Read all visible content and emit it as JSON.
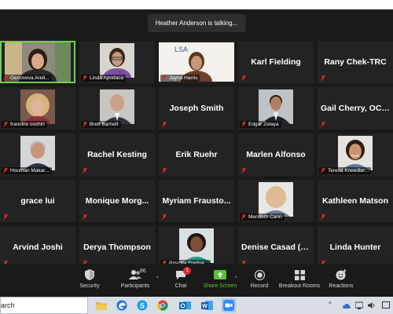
{
  "notification": {
    "text": "Heather Anderson is talking..."
  },
  "tiles": [
    {
      "name": "Genoveva Arell...",
      "display": "photo",
      "photo": "woman-dark-hair",
      "speaking": true
    },
    {
      "name": "Linda Apodaca",
      "display": "photo",
      "photo": "woman-glasses"
    },
    {
      "name": "Jayna Harris",
      "display": "photo",
      "photo": "woman-lsa-backdrop",
      "backdrop_text": "LSA"
    },
    {
      "name": "Karl Fielding",
      "display": "text"
    },
    {
      "name": "Rany Chek-TRC",
      "display": "text"
    },
    {
      "name": "francine oschin",
      "display": "photo",
      "photo": "woman-blonde"
    },
    {
      "name": "Brett Barnett",
      "display": "photo",
      "photo": "man-suit"
    },
    {
      "name": "Joseph Smith",
      "display": "text"
    },
    {
      "name": "Edgar Zelaya",
      "display": "photo",
      "photo": "man-suit-dark"
    },
    {
      "name": "Gail Cherry, OCTA",
      "display": "text"
    },
    {
      "name": "Houman Makar...",
      "display": "photo",
      "photo": "man-gray-hair"
    },
    {
      "name": "Rachel Kesting",
      "display": "text"
    },
    {
      "name": "Erik Ruehr",
      "display": "text"
    },
    {
      "name": "Marlen Alfonso",
      "display": "text"
    },
    {
      "name": "Teresa Kneedler...",
      "display": "photo",
      "photo": "woman-smiling"
    },
    {
      "name": "grace lui",
      "display": "text"
    },
    {
      "name": "Monique Morg...",
      "display": "text"
    },
    {
      "name": "Myriam Frausto...",
      "display": "text"
    },
    {
      "name": "Merideth Cann",
      "display": "photo",
      "photo": "woman-blonde-short"
    },
    {
      "name": "Kathleen Matson",
      "display": "text"
    },
    {
      "name": "Arvind Joshi",
      "display": "text"
    },
    {
      "name": "Derya Thompson",
      "display": "text"
    },
    {
      "name": "Priscilla Fredua...",
      "display": "photo",
      "photo": "woman-dark-skin"
    },
    {
      "name": "Denise Casad (E...",
      "display": "text"
    },
    {
      "name": "Linda Hunter",
      "display": "text"
    }
  ],
  "toolbar": {
    "security": {
      "label": "Security",
      "icon": "shield-icon"
    },
    "participants": {
      "label": "Participants",
      "count": "86",
      "icon": "participants-icon"
    },
    "chat": {
      "label": "Chat",
      "badge": "1",
      "icon": "chat-icon"
    },
    "share": {
      "label": "Share Screen",
      "icon": "share-screen-icon",
      "color": "#58c236"
    },
    "record": {
      "label": "Record",
      "icon": "record-icon"
    },
    "breakout": {
      "label": "Breakout Rooms",
      "icon": "breakout-rooms-icon"
    },
    "reactions": {
      "label": "Reactions",
      "icon": "reactions-icon"
    }
  },
  "taskbar": {
    "search_text": "arch",
    "apps": [
      "file-explorer-icon",
      "edge-icon",
      "skype-icon",
      "chrome-icon",
      "outlook-icon",
      "word-icon",
      "zoom-icon"
    ]
  },
  "colors": {
    "muted_mic": "#e02828",
    "speaking_border": "#6ad24d",
    "tile_bg": "#232323"
  }
}
